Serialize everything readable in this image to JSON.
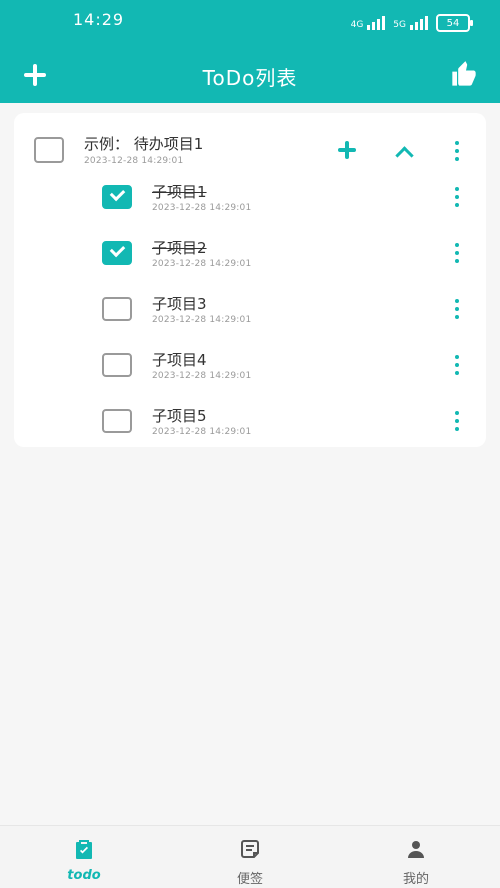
{
  "status": {
    "time": "14:29",
    "net1": "4G",
    "net2": "5G",
    "battery": "54"
  },
  "appbar": {
    "title": "ToDo列表"
  },
  "todo": {
    "main": {
      "title": "示例： 待办项目1",
      "time": "2023-12-28 14:29:01",
      "checked": false
    },
    "subitems": [
      {
        "title": "子项目1",
        "time": "2023-12-28 14:29:01",
        "checked": true
      },
      {
        "title": "子项目2",
        "time": "2023-12-28 14:29:01",
        "checked": true
      },
      {
        "title": "子项目3",
        "time": "2023-12-28 14:29:01",
        "checked": false
      },
      {
        "title": "子项目4",
        "time": "2023-12-28 14:29:01",
        "checked": false
      },
      {
        "title": "子项目5",
        "time": "2023-12-28 14:29:01",
        "checked": false
      }
    ]
  },
  "bottom_nav": {
    "tabs": [
      {
        "label": "todo",
        "icon": "clipboard-check-icon",
        "active": true
      },
      {
        "label": "便签",
        "icon": "note-icon",
        "active": false
      },
      {
        "label": "我的",
        "icon": "user-icon",
        "active": false
      }
    ]
  },
  "colors": {
    "accent": "#12b8b3"
  }
}
